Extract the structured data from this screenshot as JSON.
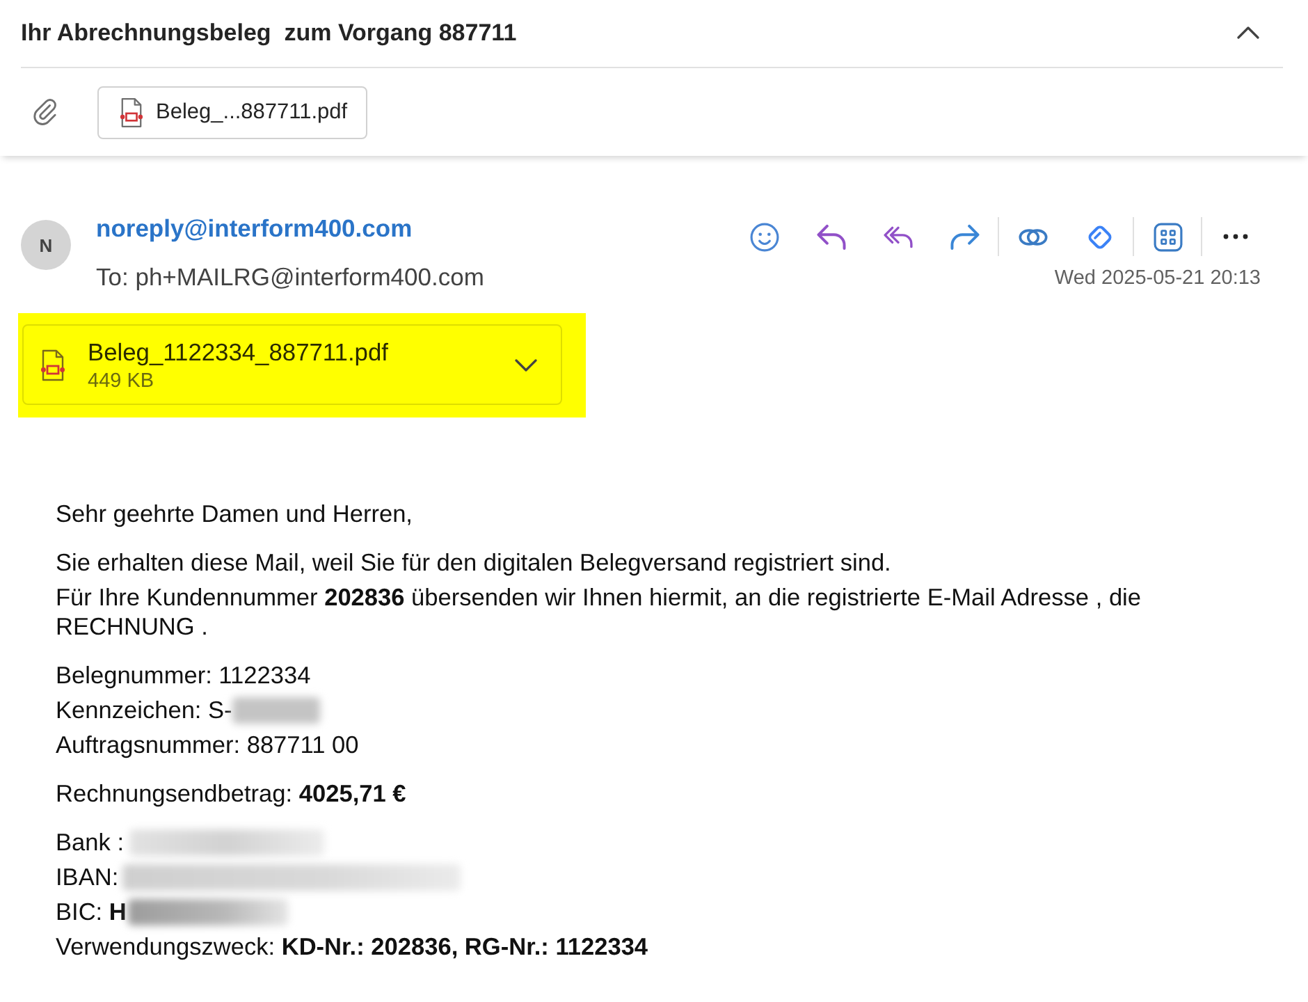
{
  "subject": {
    "title": "Ihr Abrechnungsbeleg  zum Vorgang 887711",
    "expanded": true
  },
  "attachment_bar": {
    "attachments": [
      {
        "name": "Beleg_...887711.pdf"
      }
    ]
  },
  "message": {
    "avatar_initial": "N",
    "sender": "noreply@interform400.com",
    "recipient": "To: ph+MAILRG@interform400.com",
    "date": "Wed 2025-05-21 20:13",
    "attachment": {
      "name": "Beleg_1122334_887711.pdf",
      "size": "449 KB",
      "highlighted": true
    },
    "body": [
      {
        "lines": [
          {
            "kind": "plain",
            "text": "Sehr geehrte Damen und Herren,"
          }
        ]
      },
      {
        "lines": [
          {
            "kind": "plain",
            "text": "Sie erhalten diese Mail, weil Sie für den digitalen Belegversand registriert sind."
          },
          {
            "kind": "plain",
            "text": "Für Ihre Kundennummer **202836** übersenden wir Ihnen hiermit, an die registrierte E-Mail Adresse , die RECHNUNG ."
          }
        ]
      },
      {
        "lines": [
          {
            "kind": "plain",
            "text": "Belegnummer: 1122334"
          },
          {
            "kind": "redacted",
            "text": "Kennzeichen: S-"
          },
          {
            "kind": "plain",
            "text": "Auftragsnummer: 887711 00"
          }
        ]
      },
      {
        "lines": [
          {
            "kind": "plain",
            "text": "Rechnungsendbetrag: **4025,71 €**"
          }
        ]
      },
      {
        "lines": [
          {
            "kind": "redacted",
            "text": "Bank :"
          },
          {
            "kind": "redacted",
            "text": "IBAN:"
          },
          {
            "kind": "redacted",
            "text": "BIC: **H**"
          },
          {
            "kind": "plain",
            "text": "Verwendungszweck: **KD-Nr.: 202836, RG-Nr.: 1122334**"
          }
        ]
      }
    ]
  }
}
